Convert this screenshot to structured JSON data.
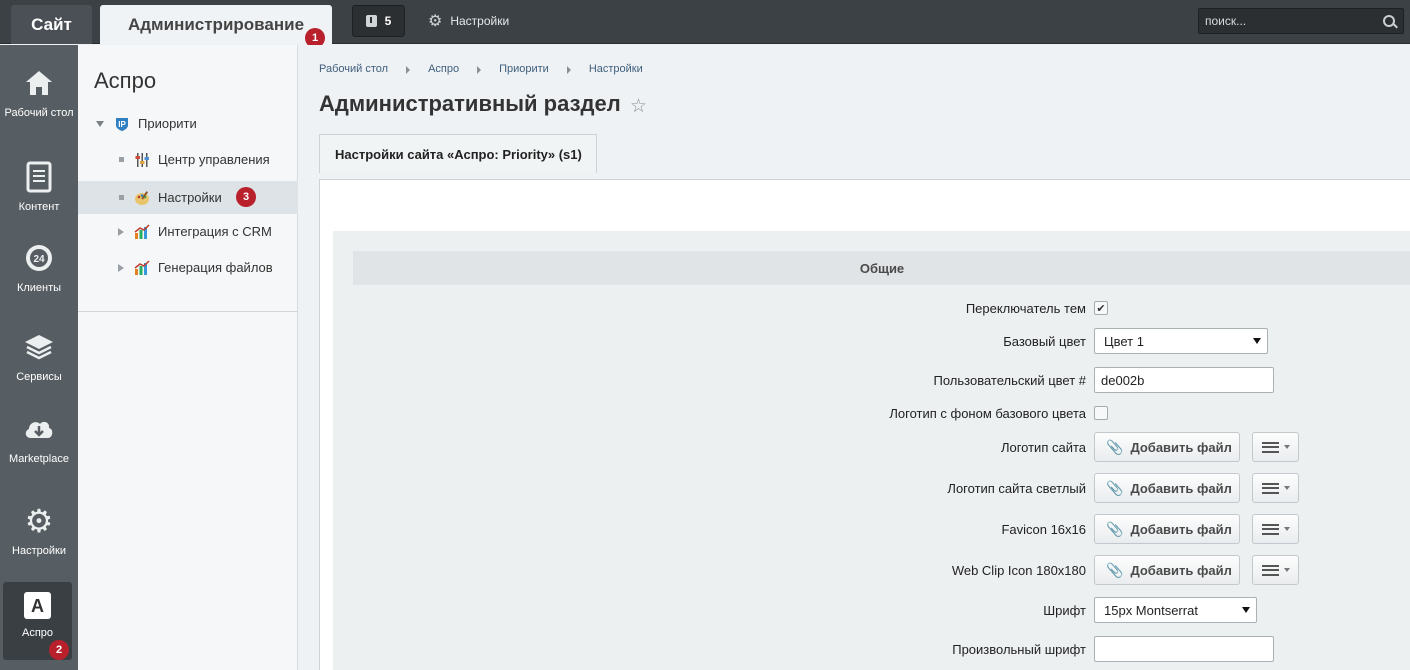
{
  "topbar": {
    "site_tab": "Сайт",
    "admin_tab": "Администрирование",
    "notifications_count": "5",
    "settings_label": "Настройки",
    "search_placeholder": "поиск..."
  },
  "badges": {
    "one": "1",
    "two": "2",
    "three": "3"
  },
  "leftnav": {
    "items": [
      {
        "label": "Рабочий стол",
        "icon": "home-icon"
      },
      {
        "label": "Контент",
        "icon": "document-icon"
      },
      {
        "label": "Клиенты",
        "icon": "clock-24-icon"
      },
      {
        "label": "Сервисы",
        "icon": "layers-icon"
      },
      {
        "label": "Marketplace",
        "icon": "cloud-download-icon"
      },
      {
        "label": "Настройки",
        "icon": "gear-icon"
      },
      {
        "label": "Аспро",
        "icon": "aspro-a-icon"
      }
    ]
  },
  "submenu": {
    "title": "Аспро",
    "items": [
      {
        "label": "Приорити"
      },
      {
        "label": "Центр управления"
      },
      {
        "label": "Настройки"
      },
      {
        "label": "Интеграция с CRM"
      },
      {
        "label": "Генерация файлов"
      }
    ]
  },
  "breadcrumb": [
    "Рабочий стол",
    "Аспро",
    "Приорити",
    "Настройки"
  ],
  "page_title": "Административный раздел",
  "content_tab": "Настройки сайта «Аспро: Priority» (s1)",
  "section_title": "Общие",
  "form": {
    "theme_switcher": {
      "label": "Переключатель тем",
      "checked": true
    },
    "base_color": {
      "label": "Базовый цвет",
      "value": "Цвет 1"
    },
    "custom_color": {
      "label": "Пользовательский цвет #",
      "value": "de002b"
    },
    "logo_bg": {
      "label": "Логотип с фоном базового цвета",
      "checked": false
    },
    "logo": {
      "label": "Логотип сайта"
    },
    "logo_light": {
      "label": "Логотип сайта светлый"
    },
    "favicon": {
      "label": "Favicon 16x16"
    },
    "webclip": {
      "label": "Web Clip Icon 180x180"
    },
    "font": {
      "label": "Шрифт",
      "value": "15px Montserrat"
    },
    "custom_font": {
      "label": "Произвольный шрифт",
      "value": ""
    },
    "add_file_label": "Добавить файл"
  }
}
